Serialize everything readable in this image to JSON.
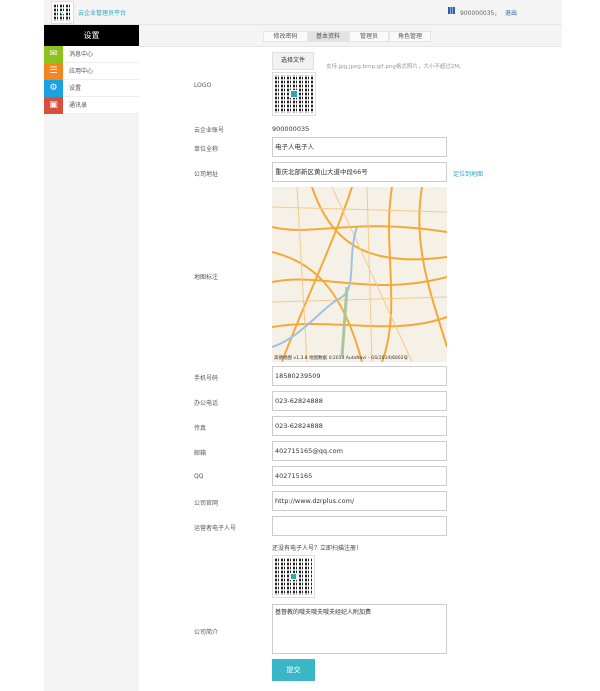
{
  "header": {
    "platform_title": "云企业管理员平台",
    "account": "900000035，",
    "logout": "退出"
  },
  "sidebar": {
    "title": "设置",
    "items": [
      {
        "label": "消息中心",
        "icon": "mail-icon",
        "color": "#8cc21e"
      },
      {
        "label": "应用中心",
        "icon": "list-icon",
        "color": "#f5861f"
      },
      {
        "label": "设置",
        "icon": "gear-icon",
        "color": "#1ba1e2"
      },
      {
        "label": "通讯录",
        "icon": "contacts-icon",
        "color": "#d94f3d"
      }
    ]
  },
  "tabs": [
    {
      "label": "修改密码"
    },
    {
      "label": "基本资料",
      "active": true
    },
    {
      "label": "管理员"
    },
    {
      "label": "角色管理"
    }
  ],
  "form": {
    "logo_label": "LOGO",
    "choose_file": "选择文件",
    "file_hint": "支持.jpg,jpeg,bmp,gif,png格式照片，大小不超过2M。",
    "account_label": "云企业账号",
    "account_value": "900000035",
    "name_label": "单位全称",
    "name_value": "电子人电子人",
    "address_label": "公司地址",
    "address_value": "重庆北部新区黄山大道中段66号",
    "locate_link": "定位到地图",
    "map_label": "地图标注",
    "map_attribution": "高德地图 v1.3.8 地图数据 ©2014 AutoNavi - GS(2014)6002号",
    "mobile_label": "手机号码",
    "mobile_value": "18580239509",
    "office_label": "办公电话",
    "office_value": "023-62824888",
    "fax_label": "传真",
    "fax_value": "023-62824888",
    "email_label": "邮箱",
    "email_value": "402715165@qq.com",
    "qq_label": "QQ",
    "qq_value": "402715165",
    "website_label": "公司官网",
    "website_value": "http://www.dzrplus.com/",
    "operator_label": "运营者电子人号",
    "operator_value": "",
    "register_hint": "还没有电子人号？立即扫描注册！",
    "intro_label": "公司简介",
    "intro_value": "基督教的哦夫哦夫哦夫经纪人附加费",
    "submit": "提交"
  },
  "colors": {
    "accent": "#3bb6c6",
    "map_roads": "#f5a83a"
  }
}
